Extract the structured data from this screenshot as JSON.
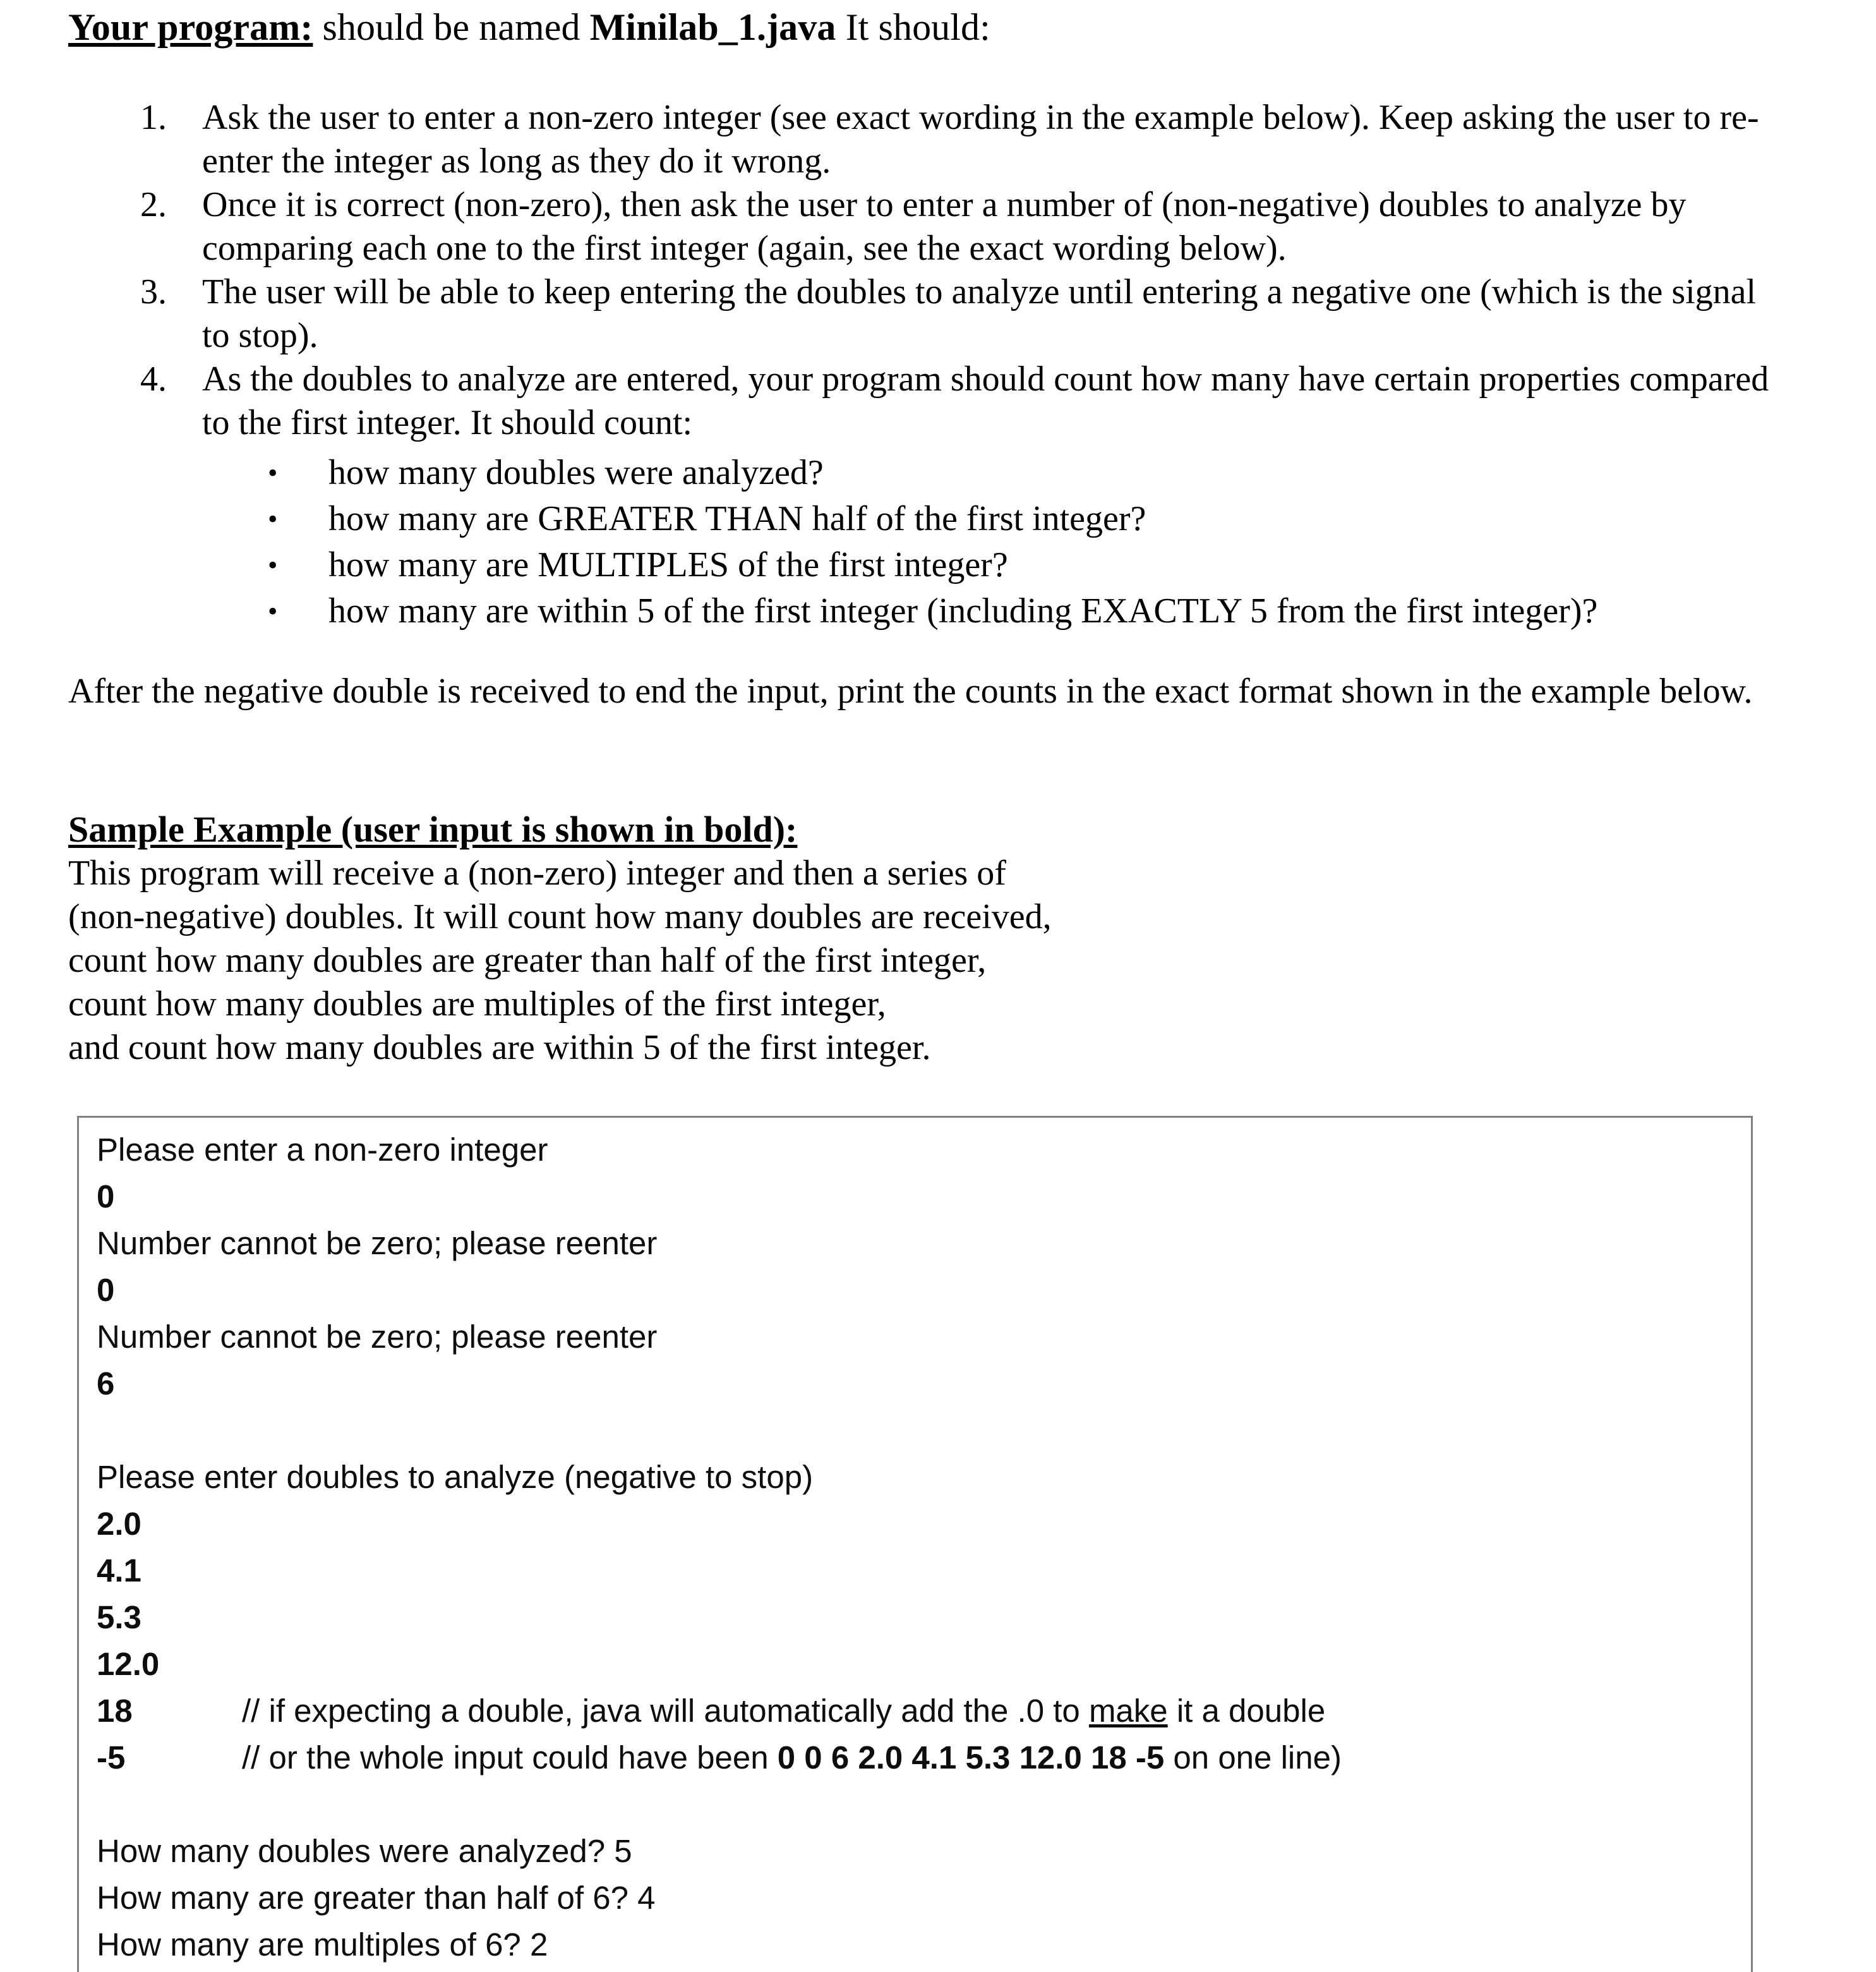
{
  "document": {
    "title_prefix": "Your program:",
    "title_mid": " should be named ",
    "title_file": "Minilab_1.java",
    "title_suffix": " It should:",
    "numbered_items": [
      {
        "marker": "1.",
        "text": "Ask the user to enter a non-zero integer (see exact wording in the example below). Keep asking the user to re-enter the integer as long as they do it wrong."
      },
      {
        "marker": "2.",
        "text": "Once it is correct (non-zero), then ask the user to enter a number of (non-negative) doubles to analyze by comparing each one to the first integer (again, see the exact wording below)."
      },
      {
        "marker": "3.",
        "text": "The user will be able to keep entering the doubles to analyze until entering a negative one (which is the signal to stop)."
      },
      {
        "marker": "4.",
        "text": "As the doubles to analyze are entered, your program should count how many have certain properties compared to the first integer. It should count:"
      }
    ],
    "bullet_marker": "•",
    "bullet_items": [
      "how many doubles were analyzed?",
      "how many are GREATER THAN half of the first integer?",
      "how many are MULTIPLES of the first integer?",
      "how many are within 5 of the first integer (including EXACTLY 5 from the first integer)?"
    ],
    "after_paragraph": "After the negative double is received to end the input, print the counts in the exact format shown in the example below.",
    "sample_heading": "Sample Example (user input is shown in bold):",
    "sample_description_lines": [
      "This program will receive a (non-zero) integer and then a series of",
      "(non-negative) doubles. It will count how many doubles are received,",
      "count how many doubles are greater than half of the first integer,",
      "count how many doubles are multiples of the first integer,",
      "and count how many doubles are within 5 of the first integer."
    ]
  },
  "console": {
    "lines": [
      {
        "type": "output",
        "text": "Please enter a non-zero integer"
      },
      {
        "type": "input",
        "text": "0"
      },
      {
        "type": "output",
        "text": "Number cannot be zero; please reenter"
      },
      {
        "type": "input",
        "text": "0"
      },
      {
        "type": "output",
        "text": "Number cannot be zero; please reenter"
      },
      {
        "type": "input",
        "text": "6"
      },
      {
        "type": "blank",
        "text": ""
      },
      {
        "type": "output",
        "text": "Please enter doubles to analyze (negative to stop)"
      },
      {
        "type": "input",
        "text": "2.0"
      },
      {
        "type": "input",
        "text": "4.1"
      },
      {
        "type": "input",
        "text": "5.3"
      },
      {
        "type": "input",
        "text": "12.0"
      },
      {
        "type": "comment1",
        "value": "18"
      },
      {
        "type": "comment2",
        "value": "-5"
      },
      {
        "type": "blank",
        "text": ""
      },
      {
        "type": "output",
        "text": "How many doubles were analyzed? 5"
      },
      {
        "type": "output",
        "text": "How many are greater than half of 6? 4"
      },
      {
        "type": "output",
        "text": "How many are multiples of 6? 2"
      }
    ],
    "comment_18": {
      "value": "18",
      "before": "// if expecting a double, java will automatically add the .0 to ",
      "spell_flag": "make",
      "after": " it a double"
    },
    "comment_neg5": {
      "value": "-5",
      "before": "// or the whole input could have been  ",
      "bold_sequence": "0  0  6  2.0  4.1  5.3  12.0  18  -5",
      "after": " on one line)"
    }
  },
  "colors": {
    "text": "#000000",
    "console_text": "#0d0d0d",
    "box_border": "#808080",
    "background": "#ffffff"
  }
}
